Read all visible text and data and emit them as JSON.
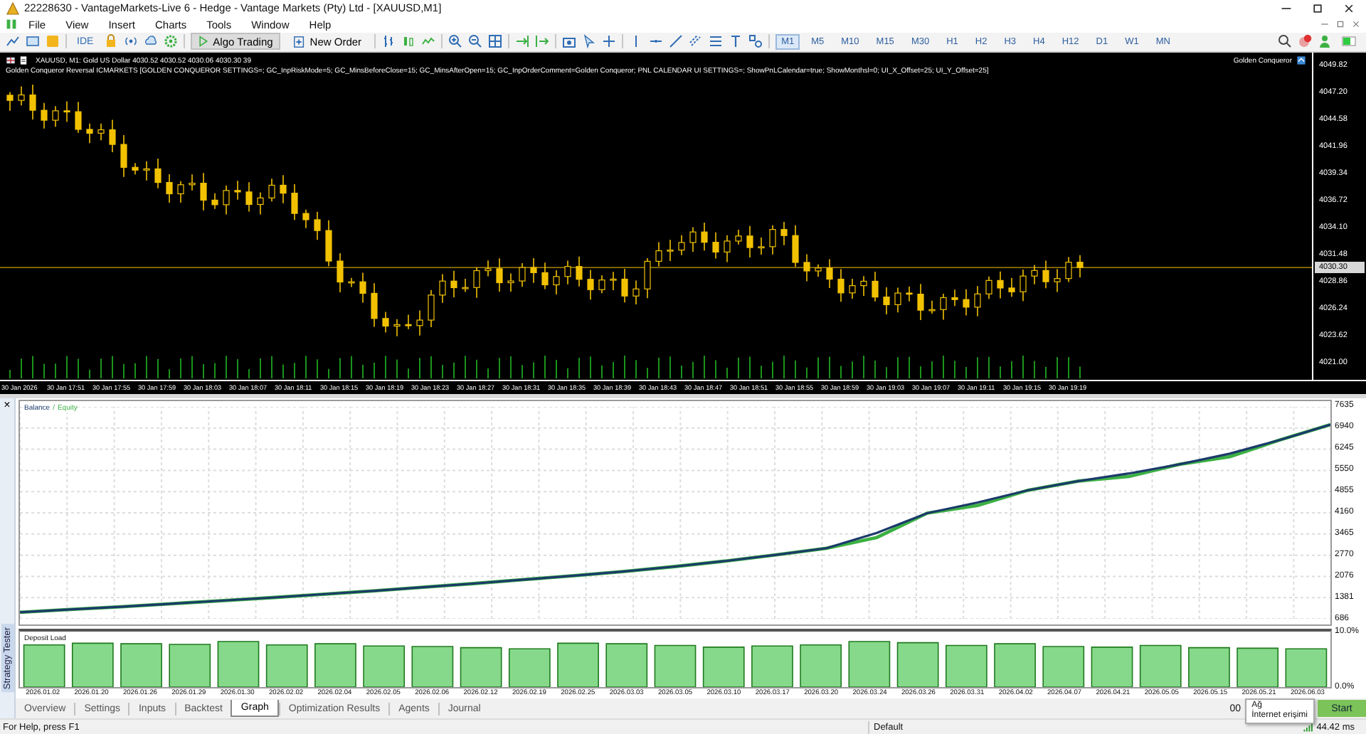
{
  "window": {
    "title": "22228630 - VantageMarkets-Live 6 - Hedge - Vantage Markets (Pty) Ltd - [XAUUSD,M1]"
  },
  "menu": [
    "File",
    "View",
    "Insert",
    "Charts",
    "Tools",
    "Window",
    "Help"
  ],
  "toolbar": {
    "ide_label": "IDE",
    "algo_trading": {
      "label": "Algo Trading",
      "on": true
    },
    "new_order": "New Order",
    "timeframes": [
      {
        "label": "M1",
        "selected": true
      },
      {
        "label": "M5",
        "selected": false
      },
      {
        "label": "M10",
        "selected": false
      },
      {
        "label": "M15",
        "selected": false
      },
      {
        "label": "M30",
        "selected": false
      },
      {
        "label": "H1",
        "selected": false
      },
      {
        "label": "H2",
        "selected": false
      },
      {
        "label": "H3",
        "selected": false
      },
      {
        "label": "H4",
        "selected": false
      },
      {
        "label": "H12",
        "selected": false
      },
      {
        "label": "D1",
        "selected": false
      },
      {
        "label": "W1",
        "selected": false
      },
      {
        "label": "MN",
        "selected": false
      }
    ]
  },
  "chart": {
    "symbol_line": "XAUUSD, M1:  Gold US Dollar  4030.52 4030.52 4030.06 4030.30  39",
    "expert_line": "Golden Conqueror Reversal ICMARKETS [GOLDEN CONQUEROR SETTINGS=; GC_InpRiskMode=5; GC_MinsBeforeClose=15; GC_MinsAfterOpen=15; GC_InpOrderComment=Golden Conqueror; PNL CALENDAR UI SETTINGS=; ShowPnLCalendar=true; ShowMonthsl=0; UI_X_Offset=25; UI_Y_Offset=25]",
    "expert_name": "Golden Conqueror",
    "price_axis": [
      "4049.82",
      "4047.20",
      "4044.58",
      "4041.96",
      "4039.34",
      "4036.72",
      "4034.10",
      "4031.48",
      "4028.86",
      "4026.24",
      "4023.62",
      "4021.00"
    ],
    "current_price": "4030.30",
    "time_axis": [
      "30 Jan 2026",
      "30 Jan 17:51",
      "30 Jan 17:55",
      "30 Jan 17:59",
      "30 Jan 18:03",
      "30 Jan 18:07",
      "30 Jan 18:11",
      "30 Jan 18:15",
      "30 Jan 18:19",
      "30 Jan 18:23",
      "30 Jan 18:27",
      "30 Jan 18:31",
      "30 Jan 18:35",
      "30 Jan 18:39",
      "30 Jan 18:43",
      "30 Jan 18:47",
      "30 Jan 18:51",
      "30 Jan 18:55",
      "30 Jan 18:59",
      "30 Jan 19:03",
      "30 Jan 19:07",
      "30 Jan 19:11",
      "30 Jan 19:15",
      "30 Jan 19:19"
    ]
  },
  "tester": {
    "close": "×",
    "side_tab": "Strategy Tester",
    "balance_chart": {
      "legend_separator": "/",
      "chart_data": {
        "type": "line",
        "grid": true,
        "ylim": [
          686,
          7635
        ],
        "yticks": [
          {
            "value": 686,
            "label": "686"
          },
          {
            "value": 1381,
            "label": "1381"
          },
          {
            "value": 2076,
            "label": "2076"
          },
          {
            "value": 2770,
            "label": "2770"
          },
          {
            "value": 3465,
            "label": "3465"
          },
          {
            "value": 4160,
            "label": "4160"
          },
          {
            "value": 4855,
            "label": "4855"
          },
          {
            "value": 5550,
            "label": "5550"
          },
          {
            "value": 6245,
            "label": "6245"
          },
          {
            "value": 6940,
            "label": "6940"
          },
          {
            "value": 7635,
            "label": "7635"
          }
        ],
        "series": [
          {
            "name": "Balance",
            "color": "#1b3a6b",
            "values": [
              900,
              990,
              1080,
              1180,
              1280,
              1380,
              1490,
              1600,
              1720,
              1840,
              1970,
              2100,
              2240,
              2400,
              2580,
              2780,
              3000,
              3500,
              4150,
              4500,
              4900,
              5200,
              5450,
              5750,
              6100,
              6550,
              7050
            ]
          },
          {
            "name": "Equity",
            "color": "#3cb043",
            "values": [
              900,
              990,
              1080,
              1180,
              1280,
              1380,
              1490,
              1600,
              1720,
              1840,
              1970,
              2100,
              2240,
              2400,
              2580,
              2780,
              3000,
              3350,
              4150,
              4400,
              4900,
              5200,
              5350,
              5750,
              6000,
              6550,
              7050
            ]
          }
        ]
      }
    },
    "deposit_chart": {
      "chart_data": {
        "type": "bar",
        "title": "Deposit Load",
        "ylim": [
          0,
          10
        ],
        "yticks": [
          {
            "value": 0,
            "label": "0.0%"
          },
          {
            "value": 10,
            "label": "10.0%"
          }
        ],
        "categories": [
          "2026.01.02",
          "2026.01.20",
          "2026.01.26",
          "2026.01.29",
          "2026.01.30",
          "2026.02.02",
          "2026.02.04",
          "2026.02.05",
          "2026.02.06",
          "2026.02.12",
          "2026.02.19",
          "2026.02.25",
          "2026.03.03",
          "2026.03.05",
          "2026.03.10",
          "2026.03.17",
          "2026.03.20",
          "2026.03.24",
          "2026.03.26",
          "2026.03.31",
          "2026.04.02",
          "2026.04.07",
          "2026.04.21",
          "2026.05.05",
          "2026.05.15",
          "2026.05.21",
          "2026.06.03"
        ],
        "values": [
          7.6,
          7.9,
          7.8,
          7.7,
          8.2,
          7.6,
          7.8,
          7.4,
          7.3,
          7.1,
          6.9,
          7.9,
          7.8,
          7.5,
          7.2,
          7.4,
          7.6,
          8.2,
          8.0,
          7.5,
          7.8,
          7.3,
          7.2,
          7.5,
          7.1,
          7.0,
          6.9
        ]
      }
    },
    "tabs": [
      {
        "label": "Overview",
        "selected": false
      },
      {
        "label": "Settings",
        "selected": false
      },
      {
        "label": "Inputs",
        "selected": false
      },
      {
        "label": "Backtest",
        "selected": false
      },
      {
        "label": "Graph",
        "selected": true
      },
      {
        "label": "Optimization Results",
        "selected": false
      },
      {
        "label": "Agents",
        "selected": false
      },
      {
        "label": "Journal",
        "selected": false
      }
    ],
    "timer": "00",
    "start_button": "Start"
  },
  "tooltip": {
    "title": "Ağ",
    "text": "İnternet erişimi"
  },
  "status_bar": {
    "help": "For Help, press F1",
    "profile": "Default",
    "ping": "44.42 ms"
  }
}
